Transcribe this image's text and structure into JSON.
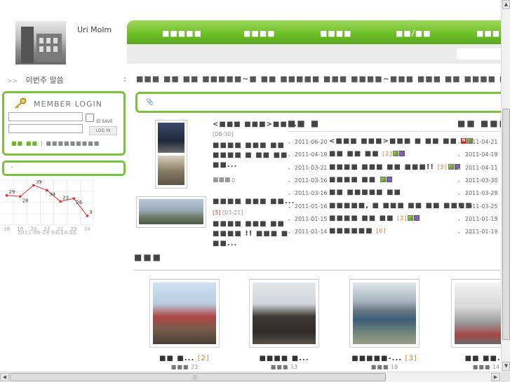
{
  "logo": {
    "text": "Uri Molm"
  },
  "nav": {
    "items": [
      "■■■■■",
      "■■■■",
      "■■■■",
      "■■/■■",
      "■■■"
    ]
  },
  "weekly": {
    "arrows": ">>",
    "label": "이번주 말씀",
    "colon": ":"
  },
  "login": {
    "title": "MEMBER  LOGIN",
    "id_save": "ID SAVE",
    "button": "LOG IN",
    "links_green": "■■ ■■",
    "links_sep": "|",
    "links_gray": "■■■■■■■■■"
  },
  "side_box2": {
    "chevron": "›"
  },
  "chart_data": {
    "type": "line",
    "x": [
      "18",
      "19",
      "20",
      "21",
      "22",
      "23",
      "24"
    ],
    "values": [
      29,
      28,
      39,
      34,
      23,
      26,
      9
    ],
    "date_label": "2011-06-24 04:14:05",
    "color": "#e03030"
  },
  "headline": "■■■ ■■ ■■ ■■■■■~■ ■■ ■■■■■ ■■■ ■■■■~■■■ ■■■ ■■ ■■■■ ■■■■■",
  "notice": {
    "pin": "📎"
  },
  "articles": [
    {
      "title": "<■■■ ■■■>■■ ...",
      "date": "[06-30]",
      "body1": "■■■■ ■■■ ■■",
      "body2": "■■■■ ■ ■■ ■■",
      "body3": "■■...",
      "count": "0"
    },
    {
      "title": "■■■■ ■■■ ■■...",
      "num": "[3]",
      "date": "[03-21]",
      "body1": "■■■■ ■■■ ■■",
      "body2": "■■■■ !! ■■■ ■",
      "body3": "■■..."
    }
  ],
  "col2": {
    "title": "■■ ■",
    "rows": [
      {
        "date": "2011-06-20",
        "title": "<■■■ ■■■>■■■ ■ ■■ ■■",
        "count": ""
      },
      {
        "date": "2011-04-19",
        "title": "■■ ■■ ■■",
        "count": "[2]"
      },
      {
        "date": "2011-03-21",
        "title": "■■■■ ■■■ ■■ ■■■!!",
        "count": "[3]"
      },
      {
        "date": "2011-03-16",
        "title": "■■■■ ■■",
        "count": ""
      },
      {
        "date": "2011-03-16",
        "title": "■■ ■■■■■ ■■",
        "count": ""
      },
      {
        "date": "2011-01-16",
        "title": "■■■■■, ■ ■■■ ■■ ■■ ■■■■",
        "count": ""
      },
      {
        "date": "2011-01-15",
        "title": "■■■■ ■■ ■■",
        "count": "[3]"
      },
      {
        "date": "2011-01-14",
        "title": "■■■■■■",
        "count": "[6]"
      }
    ]
  },
  "col3": {
    "title": "■■ ■■■",
    "dates": [
      "2011-04-21",
      "2011-04-19",
      "2011-04-11",
      "2011-03-30",
      "2011-03-28",
      "2011-03-25",
      "2011-01-19",
      "2011-01-19"
    ]
  },
  "gallery": {
    "title": "■■■",
    "items": [
      {
        "caption": "■■ ■...",
        "comments": "[2]",
        "views_label": "■■■",
        "views": "23"
      },
      {
        "caption": "■■■■ ■...",
        "comments": "",
        "views_label": "■■■",
        "views": "13"
      },
      {
        "caption": "■■■■■-...",
        "comments": "[3]",
        "views_label": "■■■",
        "views": "19"
      },
      {
        "caption": "■■ ■■...",
        "comments": "",
        "views_label": "■■■",
        "views": "14"
      }
    ]
  },
  "scroll": {
    "up": "▲",
    "down": "▼",
    "left": "◀",
    "right": "▶",
    "grip": "|||"
  }
}
